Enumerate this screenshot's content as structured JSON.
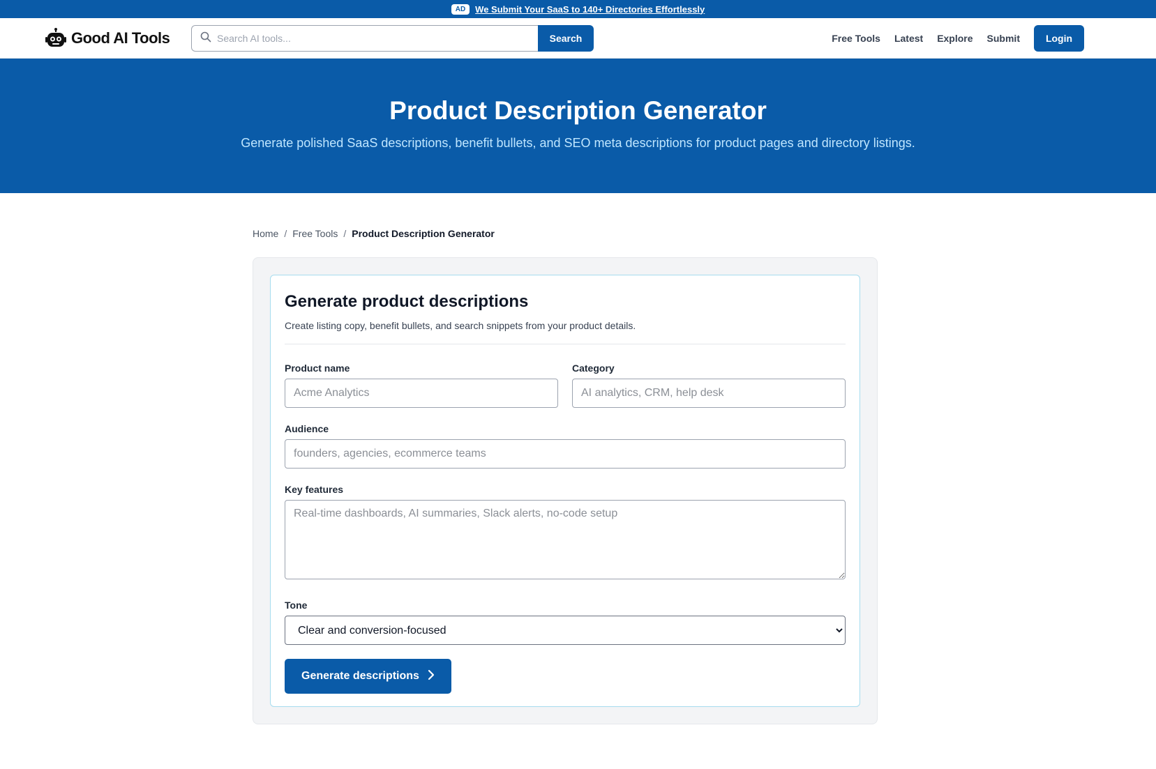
{
  "ad_bar": {
    "badge": "AD",
    "link_text": "We Submit Your SaaS to 140+ Directories Effortlessly"
  },
  "header": {
    "logo_text": "Good AI Tools",
    "logo_icon": "robot-icon",
    "search": {
      "placeholder": "Search AI tools...",
      "button_label": "Search",
      "icon": "search-icon"
    },
    "nav": [
      {
        "label": "Free Tools"
      },
      {
        "label": "Latest"
      },
      {
        "label": "Explore"
      },
      {
        "label": "Submit"
      }
    ],
    "login_label": "Login"
  },
  "hero": {
    "title": "Product Description Generator",
    "subtitle": "Generate polished SaaS descriptions, benefit bullets, and SEO meta descriptions for product pages and directory listings."
  },
  "breadcrumb": {
    "items": [
      "Home",
      "Free Tools"
    ],
    "separator": "/",
    "current": "Product Description Generator"
  },
  "form": {
    "title": "Generate product descriptions",
    "subtitle": "Create listing copy, benefit bullets, and search snippets from your product details.",
    "product_name": {
      "label": "Product name",
      "placeholder": "Acme Analytics",
      "value": ""
    },
    "category": {
      "label": "Category",
      "placeholder": "AI analytics, CRM, help desk",
      "value": ""
    },
    "audience": {
      "label": "Audience",
      "placeholder": "founders, agencies, ecommerce teams",
      "value": ""
    },
    "key_features": {
      "label": "Key features",
      "placeholder": "Real-time dashboards, AI summaries, Slack alerts, no-code setup",
      "value": ""
    },
    "tone": {
      "label": "Tone",
      "selected": "Clear and conversion-focused"
    },
    "submit_label": "Generate descriptions",
    "submit_icon": "chevron-right-icon"
  },
  "colors": {
    "brand_blue": "#0a5ba8",
    "hero_subtitle": "#bfe6ff",
    "card_border": "#a6dcef"
  }
}
